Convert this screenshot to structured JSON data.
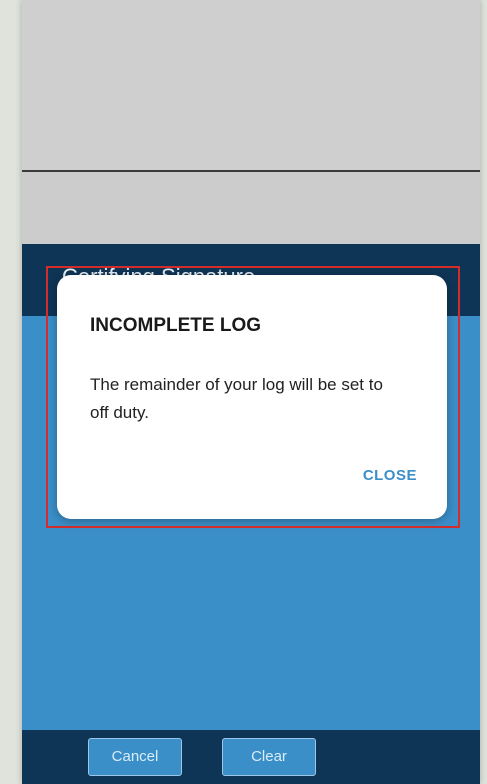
{
  "screen": {
    "title_bar_text": "Certifying Signature"
  },
  "dialog": {
    "title": "INCOMPLETE LOG",
    "message": "The remainder of your log will be set to off duty.",
    "close_label": "CLOSE"
  },
  "footer": {
    "cancel_label": "Cancel",
    "clear_label": "Clear"
  },
  "colors": {
    "header_navy": "#0f3556",
    "body_blue": "#3b8fc9",
    "highlight_red": "#d42b2b",
    "close_text": "#3b8fc9"
  }
}
